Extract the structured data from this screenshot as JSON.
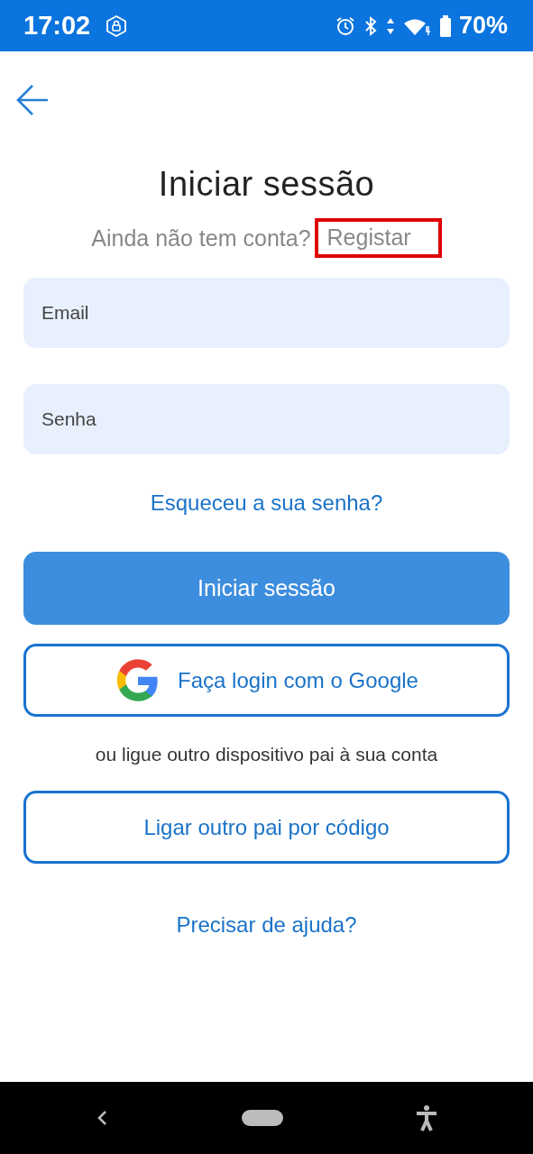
{
  "status_bar": {
    "time": "17:02",
    "battery": "70%"
  },
  "title": "Iniciar sessão",
  "register_prompt": {
    "text": "Ainda não tem conta?",
    "link": "Registar",
    "highlighted": true
  },
  "fields": [
    {
      "placeholder": "Email"
    },
    {
      "placeholder": "Senha"
    }
  ],
  "forgot_link": "Esqueceu a sua senha?",
  "login_button": "Iniciar sessão",
  "google_button": "Faça login com o Google",
  "link_text": "ou ligue outro dispositivo pai à sua conta",
  "code_button": "Ligar outro pai por código",
  "help_link": "Precisar de ajuda?"
}
